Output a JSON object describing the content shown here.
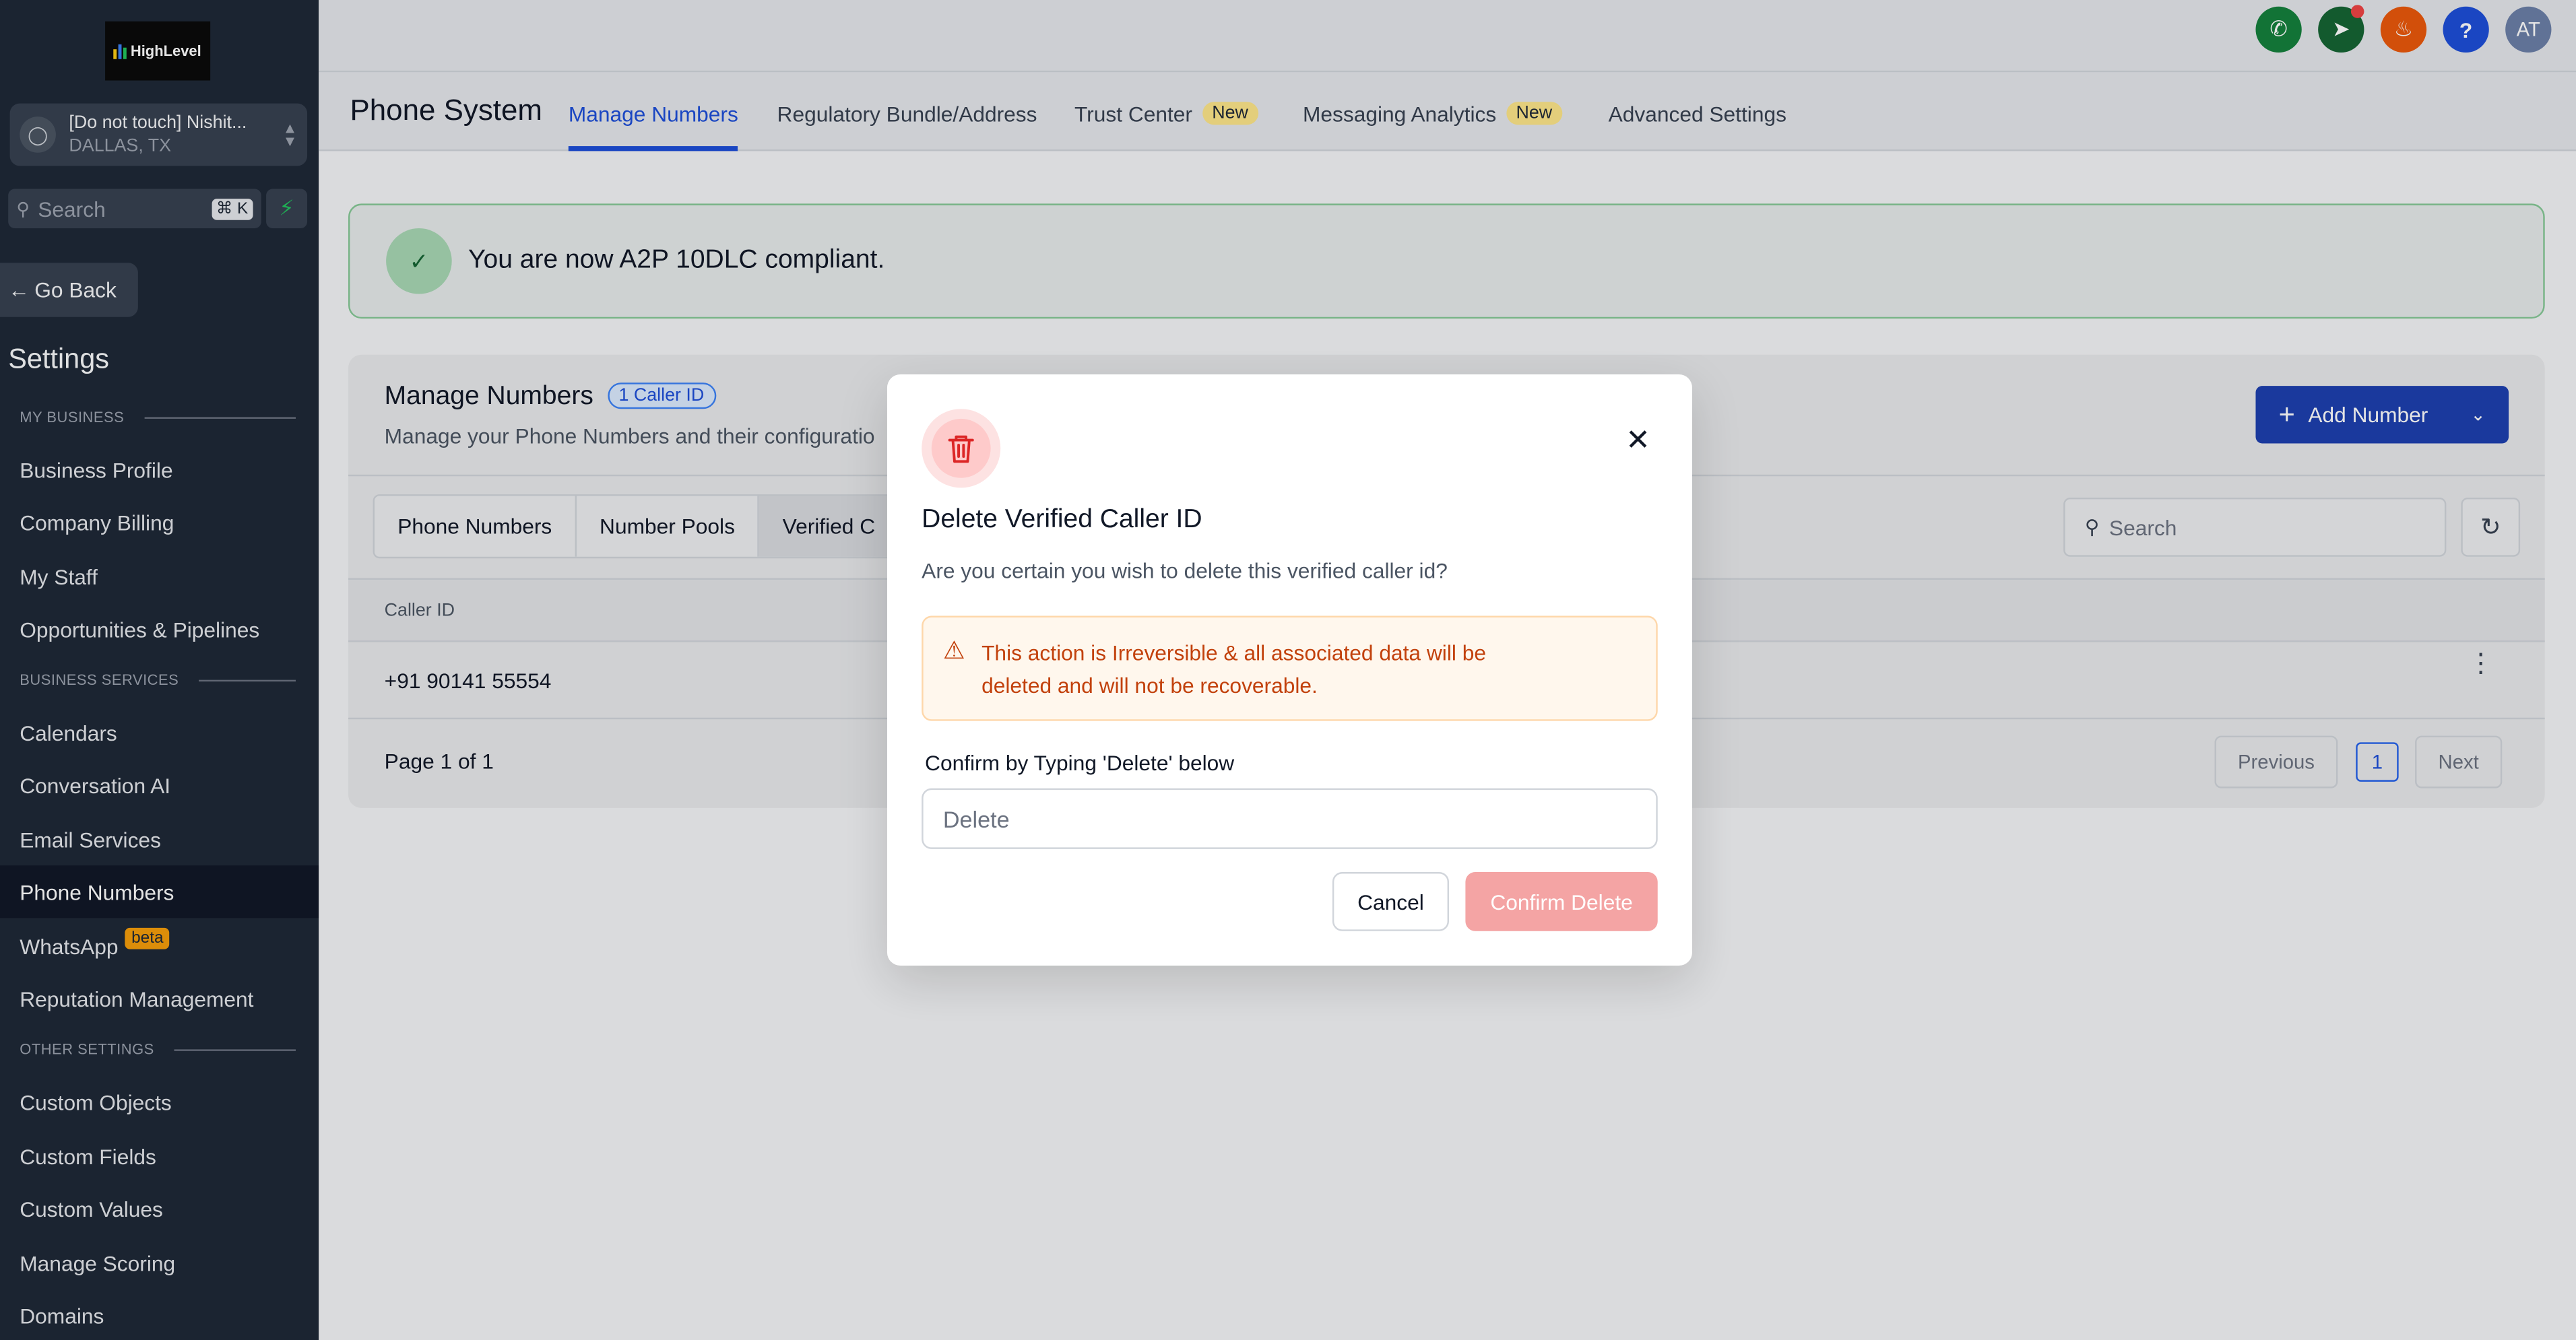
{
  "sidebar": {
    "logo_text": "HighLevel",
    "location": {
      "name": "[Do not touch] Nishit...",
      "city": "DALLAS, TX"
    },
    "search": {
      "placeholder": "Search",
      "shortcut": "⌘ K"
    },
    "go_back": "Go Back",
    "title": "Settings",
    "sections": [
      {
        "label": "MY BUSINESS",
        "items": [
          "Business Profile",
          "Company Billing",
          "My Staff",
          "Opportunities & Pipelines"
        ]
      },
      {
        "label": "BUSINESS SERVICES",
        "items": [
          "Calendars",
          "Conversation AI",
          "Email Services",
          "Phone Numbers",
          "WhatsApp",
          "Reputation Management"
        ]
      },
      {
        "label": "OTHER SETTINGS",
        "items": [
          "Custom Objects",
          "Custom Fields",
          "Custom Values",
          "Manage Scoring",
          "Domains"
        ]
      }
    ],
    "active_item": "Phone Numbers",
    "whatsapp_badge": "beta"
  },
  "topbar": {
    "avatar_initials": "AT",
    "help_label": "?"
  },
  "header": {
    "title": "Phone System",
    "tabs": [
      {
        "label": "Manage Numbers",
        "active": true,
        "badge": ""
      },
      {
        "label": "Regulatory Bundle/Address",
        "active": false,
        "badge": ""
      },
      {
        "label": "Trust Center",
        "active": false,
        "badge": "New"
      },
      {
        "label": "Messaging Analytics",
        "active": false,
        "badge": "New"
      },
      {
        "label": "Advanced Settings",
        "active": false,
        "badge": ""
      }
    ]
  },
  "banner": {
    "message": "You are now A2P 10DLC compliant."
  },
  "card": {
    "title": "Manage Numbers",
    "badge": "1 Caller ID",
    "subtitle": "Manage your Phone Numbers and their configuratio",
    "add_button": "Add Number",
    "segments": [
      "Phone Numbers",
      "Number Pools",
      "Verified C"
    ],
    "search_placeholder": "Search",
    "table": {
      "columns": [
        "Caller ID"
      ],
      "rows": [
        [
          "+91 90141 55554"
        ]
      ]
    },
    "pagination": {
      "info": "Page 1 of 1",
      "previous": "Previous",
      "current": "1",
      "next": "Next"
    }
  },
  "modal": {
    "title": "Delete Verified Caller ID",
    "subtitle": "Are you certain you wish to delete this verified caller id?",
    "warning": "This action is Irreversible & all associated data will be deleted and will not be recoverable.",
    "confirm_label": "Confirm by Typing 'Delete' below",
    "input_placeholder": "Delete",
    "input_value": "",
    "cancel": "Cancel",
    "confirm": "Confirm Delete"
  },
  "colors": {
    "accent": "#1d4ed8",
    "sidebar": "#1f2937",
    "danger": "#f4a4a4",
    "warning_text": "#c2410c",
    "success": "#86c997"
  }
}
